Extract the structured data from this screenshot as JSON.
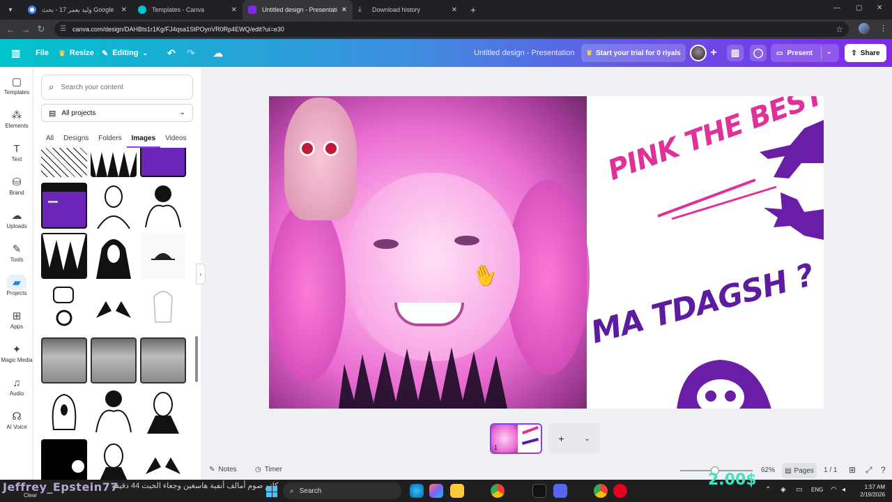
{
  "browser": {
    "tabs": [
      {
        "title": "وليد بعمر 17 - بحث Google",
        "favicon_color": "#4285f4",
        "active": false
      },
      {
        "title": "Templates - Canva",
        "favicon_color": "#00c4cc",
        "active": false
      },
      {
        "title": "Untitled design - Presentation",
        "favicon_color": "#7d2ae8",
        "active": true
      },
      {
        "title": "Download history",
        "favicon_color": "#9aa0a6",
        "active": false
      }
    ],
    "url": "canva.com/design/DAHBts1r1Kg/FJ4qsa1StPOynVR0Rp4EWQ/edit?ui=e30"
  },
  "header": {
    "file": "File",
    "resize": "Resize",
    "editing": "Editing",
    "doc_title": "Untitled design - Presentation",
    "trial": "Start your trial for 0 riyals",
    "present": "Present",
    "share": "Share"
  },
  "rail": [
    {
      "label": "Templates",
      "icon": "template-icon",
      "glyph": "▢"
    },
    {
      "label": "Elements",
      "icon": "elements-icon",
      "glyph": "⁂"
    },
    {
      "label": "Text",
      "icon": "text-icon",
      "glyph": "T"
    },
    {
      "label": "Brand",
      "icon": "brand-icon",
      "glyph": "⛁"
    },
    {
      "label": "Uploads",
      "icon": "upload-icon",
      "glyph": "☁"
    },
    {
      "label": "Tools",
      "icon": "tools-icon",
      "glyph": "✎"
    },
    {
      "label": "Projects",
      "icon": "folder-icon",
      "glyph": "▰"
    },
    {
      "label": "Apps",
      "icon": "apps-icon",
      "glyph": "⊞"
    },
    {
      "label": "Magic Media",
      "icon": "magic-media-icon",
      "glyph": "✦"
    },
    {
      "label": "Audio",
      "icon": "audio-icon",
      "glyph": "♫"
    },
    {
      "label": "AI Voice",
      "icon": "ai-voice-icon",
      "glyph": "☊"
    }
  ],
  "panel": {
    "search_placeholder": "Search your content",
    "projects_filter": "All projects",
    "subtabs": [
      "All",
      "Designs",
      "Folders",
      "Images",
      "Videos"
    ],
    "active_subtab": "Images"
  },
  "slide": {
    "headline1": "PINK THE BEST",
    "headline2": "MA TDAGSH ?"
  },
  "filmstrip": {
    "page_number": "1"
  },
  "statusbar": {
    "notes": "Notes",
    "timer": "Timer",
    "zoom": "62%",
    "pages": "Pages",
    "page_count": "1 / 1"
  },
  "taskbar": {
    "weather_overlay": "Jeffrey_Epstein77",
    "weather_sub": "Clear",
    "ticker": "كاتم صوم أمالف أنفية هاسغين وجعاء الخيت 44 دقيقة",
    "money_overlay": "2.00$",
    "search": "Search",
    "lang": "ENG",
    "time": "1:57 AM",
    "date": "2/19/2026"
  },
  "colors": {
    "accent": "#8b3dff",
    "headline_pink": "#e0319a",
    "purple": "#6a1ea8"
  }
}
